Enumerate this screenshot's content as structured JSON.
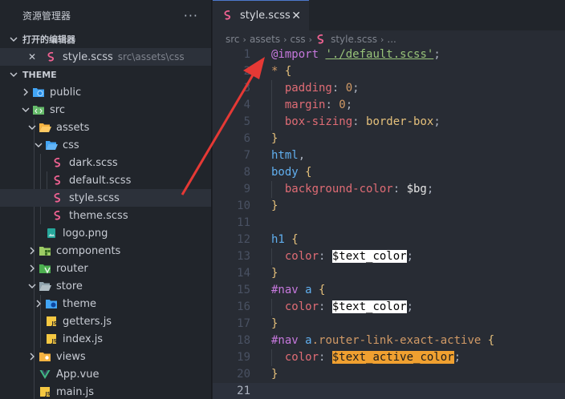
{
  "sidebar": {
    "title": "资源管理器",
    "more": "···",
    "open_editors": {
      "label": "打开的编辑器",
      "items": [
        {
          "close": "✕",
          "name": "style.scss",
          "path": "src\\assets\\css"
        }
      ]
    },
    "project": {
      "label": "THEME",
      "tree": [
        {
          "name": "public"
        },
        {
          "name": "src"
        },
        {
          "name": "assets"
        },
        {
          "name": "css"
        },
        {
          "name": "dark.scss"
        },
        {
          "name": "default.scss"
        },
        {
          "name": "style.scss"
        },
        {
          "name": "theme.scss"
        },
        {
          "name": "logo.png"
        },
        {
          "name": "components"
        },
        {
          "name": "router"
        },
        {
          "name": "store"
        },
        {
          "name": "theme"
        },
        {
          "name": "getters.js"
        },
        {
          "name": "index.js"
        },
        {
          "name": "views"
        },
        {
          "name": "App.vue"
        },
        {
          "name": "main.js"
        }
      ]
    }
  },
  "editor": {
    "tab": {
      "label": "style.scss",
      "close": "✕"
    },
    "breadcrumb": [
      "src",
      "assets",
      "css",
      "style.scss",
      "..."
    ],
    "lines": [
      {
        "n": "1",
        "t": [
          {
            "c": "at",
            "s": "@import"
          },
          {
            "c": "punc",
            "s": " "
          },
          {
            "c": "str",
            "s": "'./default.scss'"
          },
          {
            "c": "punc",
            "s": ";"
          }
        ]
      },
      {
        "n": "2",
        "t": [
          {
            "c": "sel",
            "s": "*"
          },
          {
            "c": "punc",
            "s": " "
          },
          {
            "c": "brace",
            "s": "{"
          }
        ]
      },
      {
        "n": "3",
        "t": [
          {
            "c": "punc",
            "s": "  "
          },
          {
            "c": "prop",
            "s": "padding"
          },
          {
            "c": "punc",
            "s": ": "
          },
          {
            "c": "num",
            "s": "0"
          },
          {
            "c": "punc",
            "s": ";"
          }
        ]
      },
      {
        "n": "4",
        "t": [
          {
            "c": "punc",
            "s": "  "
          },
          {
            "c": "prop",
            "s": "margin"
          },
          {
            "c": "punc",
            "s": ": "
          },
          {
            "c": "num",
            "s": "0"
          },
          {
            "c": "punc",
            "s": ";"
          }
        ]
      },
      {
        "n": "5",
        "t": [
          {
            "c": "punc",
            "s": "  "
          },
          {
            "c": "prop",
            "s": "box-sizing"
          },
          {
            "c": "punc",
            "s": ": "
          },
          {
            "c": "val",
            "s": "border-box"
          },
          {
            "c": "punc",
            "s": ";"
          }
        ]
      },
      {
        "n": "6",
        "t": [
          {
            "c": "brace",
            "s": "}"
          }
        ]
      },
      {
        "n": "7",
        "t": [
          {
            "c": "idsel",
            "s": "html"
          },
          {
            "c": "punc",
            "s": ","
          }
        ]
      },
      {
        "n": "8",
        "t": [
          {
            "c": "idsel",
            "s": "body"
          },
          {
            "c": "punc",
            "s": " "
          },
          {
            "c": "brace",
            "s": "{"
          }
        ]
      },
      {
        "n": "9",
        "t": [
          {
            "c": "punc",
            "s": "  "
          },
          {
            "c": "prop",
            "s": "background-color"
          },
          {
            "c": "punc",
            "s": ": "
          },
          {
            "c": "var",
            "s": "$bg"
          },
          {
            "c": "punc",
            "s": ";"
          }
        ]
      },
      {
        "n": "10",
        "t": [
          {
            "c": "brace",
            "s": "}"
          }
        ]
      },
      {
        "n": "11",
        "t": []
      },
      {
        "n": "12",
        "t": [
          {
            "c": "idsel",
            "s": "h1"
          },
          {
            "c": "punc",
            "s": " "
          },
          {
            "c": "brace",
            "s": "{"
          }
        ]
      },
      {
        "n": "13",
        "t": [
          {
            "c": "punc",
            "s": "  "
          },
          {
            "c": "prop",
            "s": "color"
          },
          {
            "c": "punc",
            "s": ": "
          },
          {
            "c": "hl-white",
            "s": "$text_color"
          },
          {
            "c": "punc",
            "s": ";"
          }
        ]
      },
      {
        "n": "14",
        "t": [
          {
            "c": "brace",
            "s": "}"
          }
        ]
      },
      {
        "n": "15",
        "t": [
          {
            "c": "at",
            "s": "#nav"
          },
          {
            "c": "punc",
            "s": " "
          },
          {
            "c": "idsel",
            "s": "a"
          },
          {
            "c": "punc",
            "s": " "
          },
          {
            "c": "brace",
            "s": "{"
          }
        ]
      },
      {
        "n": "16",
        "t": [
          {
            "c": "punc",
            "s": "  "
          },
          {
            "c": "prop",
            "s": "color"
          },
          {
            "c": "punc",
            "s": ": "
          },
          {
            "c": "hl-white",
            "s": "$text_color"
          },
          {
            "c": "punc",
            "s": ";"
          }
        ]
      },
      {
        "n": "17",
        "t": [
          {
            "c": "brace",
            "s": "}"
          }
        ]
      },
      {
        "n": "18",
        "t": [
          {
            "c": "at",
            "s": "#nav"
          },
          {
            "c": "punc",
            "s": " "
          },
          {
            "c": "idsel",
            "s": "a"
          },
          {
            "c": "cls",
            "s": ".router-link-exact-active"
          },
          {
            "c": "punc",
            "s": " "
          },
          {
            "c": "brace",
            "s": "{"
          }
        ]
      },
      {
        "n": "19",
        "t": [
          {
            "c": "punc",
            "s": "  "
          },
          {
            "c": "prop",
            "s": "color"
          },
          {
            "c": "punc",
            "s": ": "
          },
          {
            "c": "hl-orange",
            "s": "$text_active_color"
          },
          {
            "c": "punc",
            "s": ";"
          }
        ]
      },
      {
        "n": "20",
        "t": [
          {
            "c": "brace",
            "s": "}"
          }
        ]
      },
      {
        "n": "21",
        "t": []
      }
    ]
  },
  "colors": {
    "sidebar_bg": "#21252b",
    "editor_bg": "#282c34",
    "selection": "#2c313a",
    "arrow": "#e53935",
    "sass": "#f06292",
    "folder": "#f5b342"
  }
}
